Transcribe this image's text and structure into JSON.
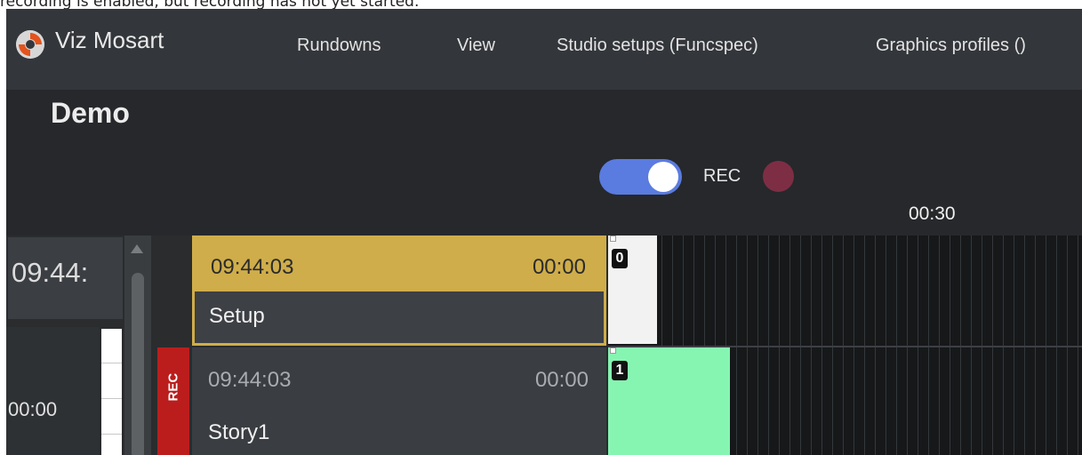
{
  "caption": "recording is enabled, but recording has not yet started.",
  "app": {
    "title": "Viz Mosart",
    "menu": [
      "Rundowns",
      "View",
      "Studio setups (Funcspec)",
      "Graphics profiles ()"
    ]
  },
  "rundown": {
    "title": "Demo",
    "rec_label": "REC",
    "rec_toggle_on": true,
    "time_marker": "00:30"
  },
  "left": {
    "clock": "09:44:",
    "duration": "00:00"
  },
  "stories": [
    {
      "time": "09:44:03",
      "duration": "00:00",
      "name": "Setup",
      "badge": "0"
    },
    {
      "time": "09:44:03",
      "duration": "00:00",
      "name": "Story1",
      "badge": "1",
      "marker": "REC"
    }
  ],
  "colors": {
    "accent_toggle": "#5a7be0",
    "rec_dot": "#7e2e44",
    "setup_highlight": "#cfad4a",
    "rec_marker": "#bb1d1d",
    "clip_green": "#86f5b2"
  }
}
